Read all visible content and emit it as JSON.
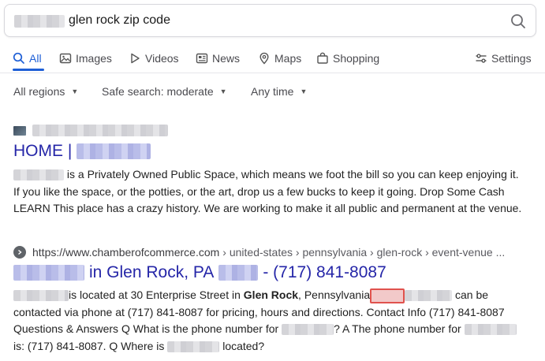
{
  "search": {
    "query": "glen rock zip code"
  },
  "tabs": [
    {
      "label": "All"
    },
    {
      "label": "Images"
    },
    {
      "label": "Videos"
    },
    {
      "label": "News"
    },
    {
      "label": "Maps"
    },
    {
      "label": "Shopping"
    }
  ],
  "settings_label": "Settings",
  "filters": {
    "region": "All regions",
    "safe_search": "Safe search: moderate",
    "time": "Any time"
  },
  "results": [
    {
      "title_prefix": "HOME |",
      "snippet_l1": "is a Privately Owned Public Space, which means we foot the bill so you can keep enjoying it.",
      "snippet_l2": "If you like the space, or the potties, or the art, drop us a few bucks to keep it going. Drop Some Cash",
      "snippet_l3": "LEARN This place has a crazy history. We are working to make it all public and permanent at the venue."
    },
    {
      "url": "https://www.chamberofcommerce.com",
      "breadcrumb": "› united-states › pennsylvania › glen-rock › event-venue ...",
      "title_mid": "in Glen Rock, PA",
      "title_phone": "- (717) 841-8087",
      "s1a": "is located at 30 Enterprise Street in",
      "s1b": "Glen Rock",
      "s1c": ", Pennsylvania",
      "s1d": "can be",
      "s2": "contacted via phone at (717) 841-8087 for pricing, hours and directions. Contact Info (717) 841-8087",
      "s3a": "Questions & Answers Q What is the phone number for",
      "s3b": "? A The phone number for",
      "s4a": "is: (717) 841-8087. Q Where is",
      "s4b": "located?"
    }
  ]
}
